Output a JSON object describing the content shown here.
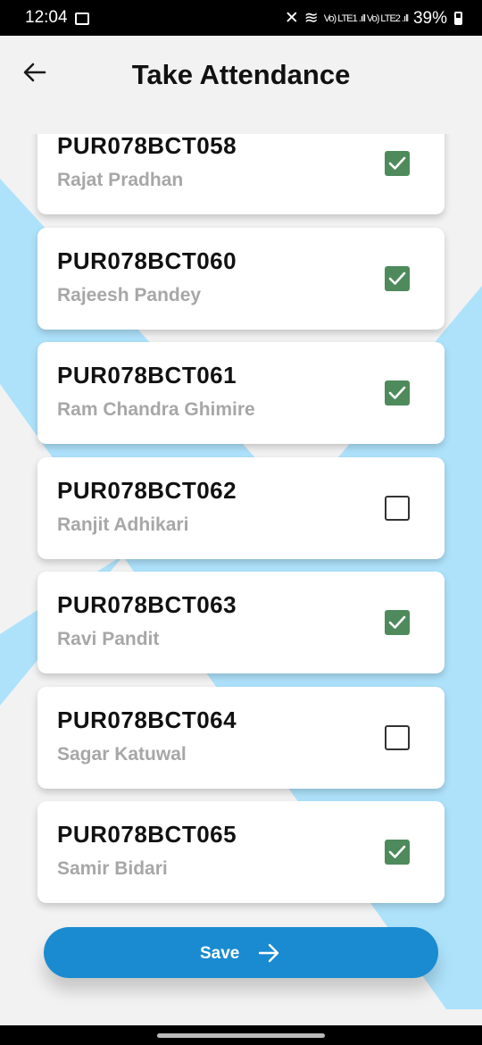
{
  "status_bar": {
    "time": "12:04",
    "signal_text": "Vo) LTE1 .ıll Vo) LTE2 .ıll",
    "battery": "39%"
  },
  "header": {
    "title": "Take Attendance"
  },
  "students": [
    {
      "id": "PUR078BCT058",
      "name": "Rajat Pradhan",
      "present": true
    },
    {
      "id": "PUR078BCT060",
      "name": "Rajeesh Pandey",
      "present": true
    },
    {
      "id": "PUR078BCT061",
      "name": "Ram Chandra Ghimire",
      "present": true
    },
    {
      "id": "PUR078BCT062",
      "name": "Ranjit Adhikari",
      "present": false
    },
    {
      "id": "PUR078BCT063",
      "name": "Ravi Pandit",
      "present": true
    },
    {
      "id": "PUR078BCT064",
      "name": "Sagar Katuwal",
      "present": false
    },
    {
      "id": "PUR078BCT065",
      "name": "Samir Bidari",
      "present": true
    }
  ],
  "save_button": {
    "label": "Save"
  },
  "colors": {
    "accent": "#1a8bd0",
    "checked": "#4e8a5c",
    "background_shape": "#aee2fb"
  }
}
